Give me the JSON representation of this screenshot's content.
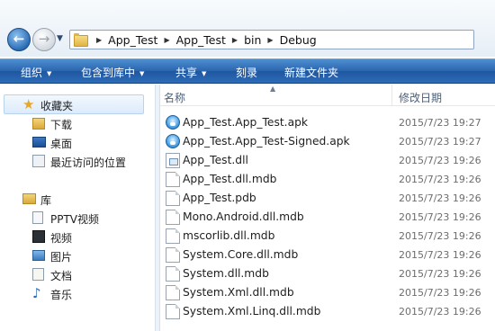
{
  "address": {
    "breadcrumbs": [
      "App_Test",
      "App_Test",
      "bin",
      "Debug"
    ]
  },
  "toolbar": {
    "items": [
      {
        "label": "组织",
        "has_dropdown": true
      },
      {
        "label": "包含到库中",
        "has_dropdown": true
      },
      {
        "label": "共享",
        "has_dropdown": true
      },
      {
        "label": "刻录",
        "has_dropdown": false
      },
      {
        "label": "新建文件夹",
        "has_dropdown": false
      }
    ]
  },
  "nav": {
    "favorites_label": "收藏夹",
    "favorites": [
      "下载",
      "桌面",
      "最近访问的位置"
    ],
    "library_label": "库",
    "libraries": [
      "PPTV视频",
      "视频",
      "图片",
      "文档",
      "音乐"
    ]
  },
  "columns": {
    "name": "名称",
    "date": "修改日期"
  },
  "files": [
    {
      "name": "App_Test.App_Test.apk",
      "date": "2015/7/23 19:27",
      "icon": "apk-icon"
    },
    {
      "name": "App_Test.App_Test-Signed.apk",
      "date": "2015/7/23 19:27",
      "icon": "apk-icon"
    },
    {
      "name": "App_Test.dll",
      "date": "2015/7/23 19:26",
      "icon": "dll-icon"
    },
    {
      "name": "App_Test.dll.mdb",
      "date": "2015/7/23 19:26",
      "icon": "file-icon"
    },
    {
      "name": "App_Test.pdb",
      "date": "2015/7/23 19:26",
      "icon": "file-icon"
    },
    {
      "name": "Mono.Android.dll.mdb",
      "date": "2015/7/23 19:26",
      "icon": "file-icon"
    },
    {
      "name": "mscorlib.dll.mdb",
      "date": "2015/7/23 19:26",
      "icon": "file-icon"
    },
    {
      "name": "System.Core.dll.mdb",
      "date": "2015/7/23 19:26",
      "icon": "file-icon"
    },
    {
      "name": "System.dll.mdb",
      "date": "2015/7/23 19:26",
      "icon": "file-icon"
    },
    {
      "name": "System.Xml.dll.mdb",
      "date": "2015/7/23 19:26",
      "icon": "file-icon"
    },
    {
      "name": "System.Xml.Linq.dll.mdb",
      "date": "2015/7/23 19:26",
      "icon": "file-icon"
    }
  ]
}
